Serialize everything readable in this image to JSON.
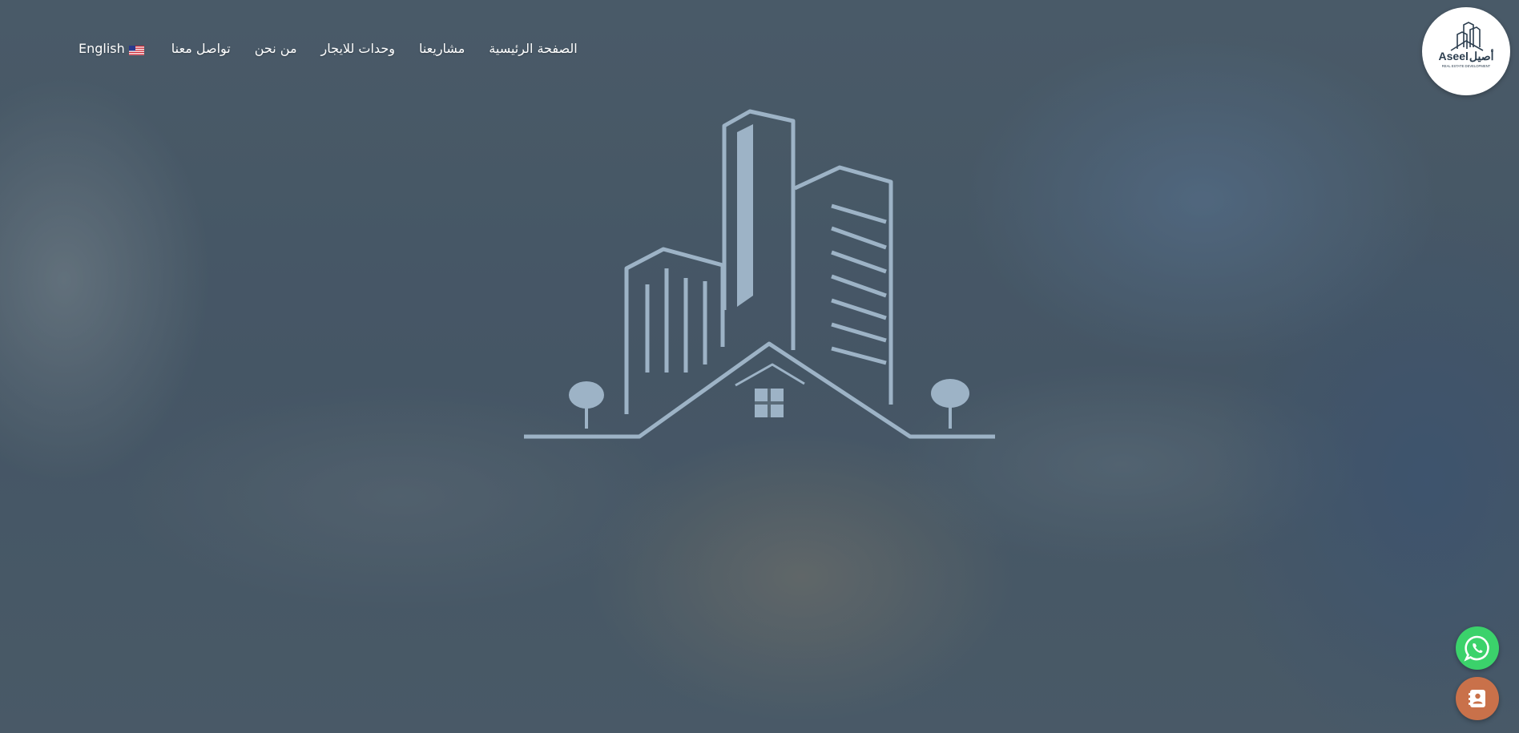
{
  "nav": {
    "items": [
      {
        "label": "English",
        "icon": "us-flag-icon"
      },
      {
        "label": "تواصل معنا"
      },
      {
        "label": "من نحن"
      },
      {
        "label": "وحدات للايجار"
      },
      {
        "label": "مشاريعنا"
      },
      {
        "label": "الصفحة الرئيسية"
      }
    ]
  },
  "logo": {
    "brand_en": "Aseel",
    "brand_ar": "أصيل",
    "tagline": "REAL ESTATE DEVELOPMENT"
  },
  "floating": {
    "whatsapp": "whatsapp-icon",
    "contact": "contact-book-icon"
  },
  "colors": {
    "whatsapp": "#3bd26b",
    "contact": "#c9714a",
    "logo_text": "#2c3e4f"
  }
}
